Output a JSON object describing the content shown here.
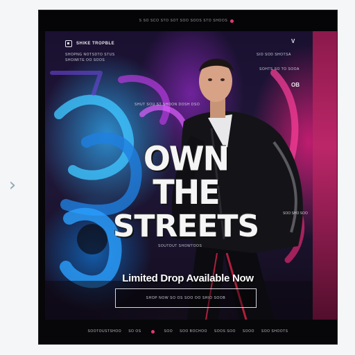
{
  "nav": {
    "arrow_glyph": "›"
  },
  "poster": {
    "top_bar": "S SO SCO STO SOT SOO SOOS STO SHOOS",
    "brand": "SHIKE TROPBLE",
    "sub_lines": [
      "SHOPNG NOTSDTO STUS",
      "SHOIMITE OO SOOS"
    ],
    "right_lines": [
      "SIO SOD SHOTSA",
      "SOHTS SO TO SOOA"
    ],
    "right_icon_top": "V",
    "right_icon_mid": "OB",
    "tag_line": "SHUT SOU ST SHOON DOSH DSO",
    "headline_line1": "OWN THE",
    "headline_line2": "STREETS",
    "small_tag": "SOUTOUT SHOWTOOS",
    "cta_text": "Limited Drop Available Now",
    "cta_button": "SHOP NOW SO OS SOO OO SHIO SOOB",
    "footer_items": [
      "SOOTOUSTSHOO",
      "SO OS",
      "SOO",
      "SOO BOCHOO",
      "SOOS SOO",
      "SOOO",
      "SOO SHOOTS"
    ],
    "side_note": "SOO SHO SOO"
  },
  "colors": {
    "accent_pink": "#e13a6f",
    "accent_blue": "#2ea0e6",
    "accent_purple": "#8c28be",
    "background": "#07070a"
  }
}
